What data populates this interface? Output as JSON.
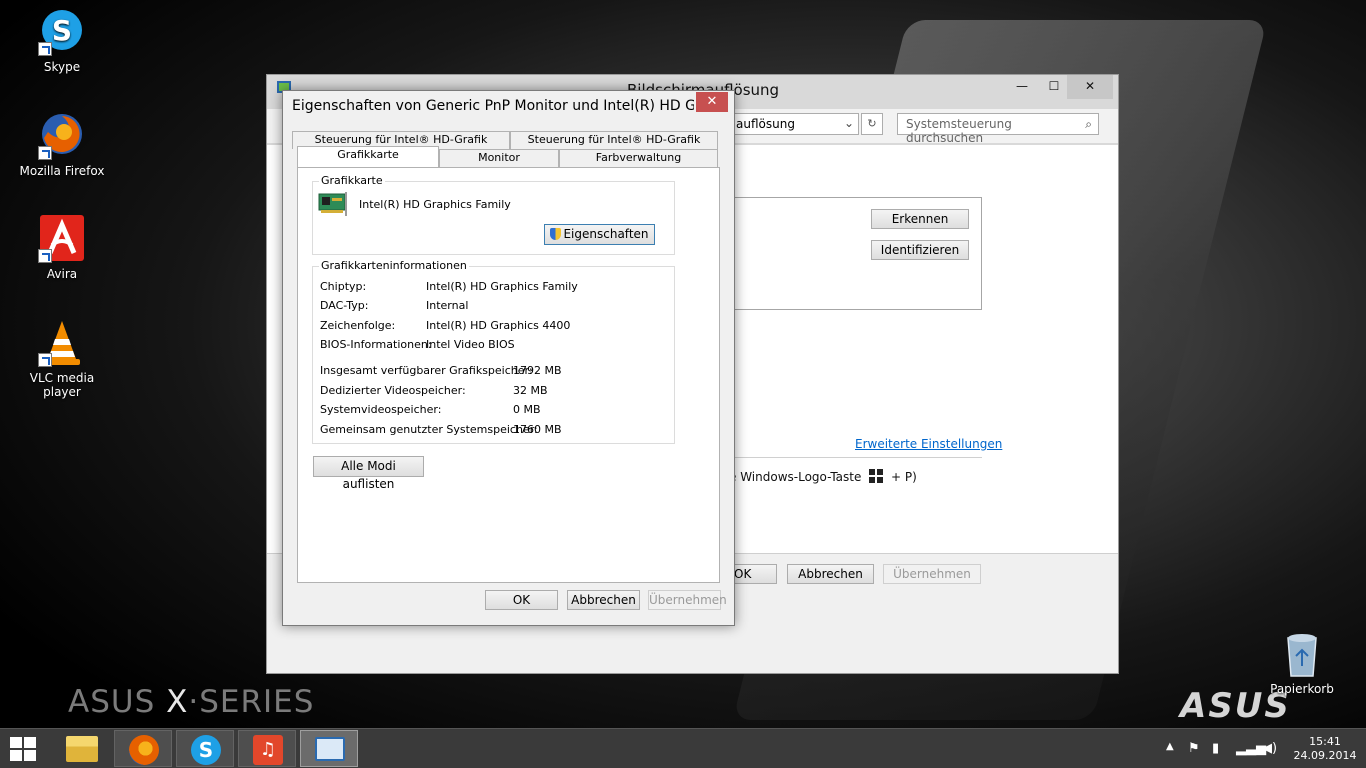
{
  "desktop": {
    "brand_left_a": "ASUS",
    "brand_left_x": "X",
    "brand_left_b": "·SERIES",
    "brand_right": "ASUS",
    "icons": [
      {
        "label": "Skype",
        "icon": "skype-icon",
        "color": "#1ea0e6"
      },
      {
        "label": "Mozilla Firefox",
        "icon": "firefox-icon",
        "color": "#e66000"
      },
      {
        "label": "Avira",
        "icon": "avira-icon",
        "color": "#e1251b"
      },
      {
        "label": "VLC media player",
        "icon": "vlc-icon",
        "color": "#f28c00"
      },
      {
        "label": "Papierkorb",
        "icon": "recycle-bin-icon",
        "color": "#9ab7cf"
      }
    ]
  },
  "bg_window": {
    "title": "Bildschirmauflösung",
    "minimize": "—",
    "maximize": "☐",
    "close": "✕",
    "address_value": "auflösung",
    "search_placeholder": "Systemsteuerung durchsuchen",
    "detect_button": "Erkennen",
    "identify_button": "Identifizieren",
    "advanced_link": "Erweiterte Einstellungen",
    "hint_prefix": "e Windows-Logo-Taste",
    "hint_suffix": "+ P)",
    "ok_button": "OK",
    "cancel_button": "Abbrechen",
    "apply_button": "Übernehmen"
  },
  "dialog": {
    "title": "Eigenschaften von Generic PnP Monitor und Intel(R) HD Grafi...",
    "close": "✕",
    "tabs_back": [
      "Steuerung für Intel® HD-Grafik",
      "Steuerung für Intel® HD-Grafik"
    ],
    "tabs_front": [
      "Grafikkarte",
      "Monitor",
      "Farbverwaltung"
    ],
    "adapter_group_label": "Grafikkarte",
    "adapter_name": "Intel(R) HD Graphics Family",
    "properties_button": "Eigenschaften",
    "info_group_label": "Grafikkarteninformationen",
    "info_rows": [
      {
        "label": "Chiptyp:",
        "value": "Intel(R) HD Graphics Family"
      },
      {
        "label": "DAC-Typ:",
        "value": "Internal"
      },
      {
        "label": "Zeichenfolge:",
        "value": "Intel(R) HD Graphics 4400"
      },
      {
        "label": "BIOS-Informationen:",
        "value": "Intel Video BIOS"
      }
    ],
    "memory_rows": [
      {
        "label": "Insgesamt verfügbarer Grafikspeicher:",
        "value": "1792 MB"
      },
      {
        "label": "Dedizierter Videospeicher:",
        "value": "32 MB"
      },
      {
        "label": "Systemvideospeicher:",
        "value": "0 MB"
      },
      {
        "label": "Gemeinsam genutzter Systemspeicher:",
        "value": "1760 MB"
      }
    ],
    "list_modes_button": "Alle Modi auflisten",
    "ok_button": "OK",
    "cancel_button": "Abbrechen",
    "apply_button": "Übernehmen"
  },
  "taskbar": {
    "apps": [
      "file-explorer-icon",
      "firefox-icon",
      "skype-icon",
      "headphones-app-icon",
      "display-settings-icon"
    ],
    "time": "15:41",
    "date": "24.09.2014"
  }
}
